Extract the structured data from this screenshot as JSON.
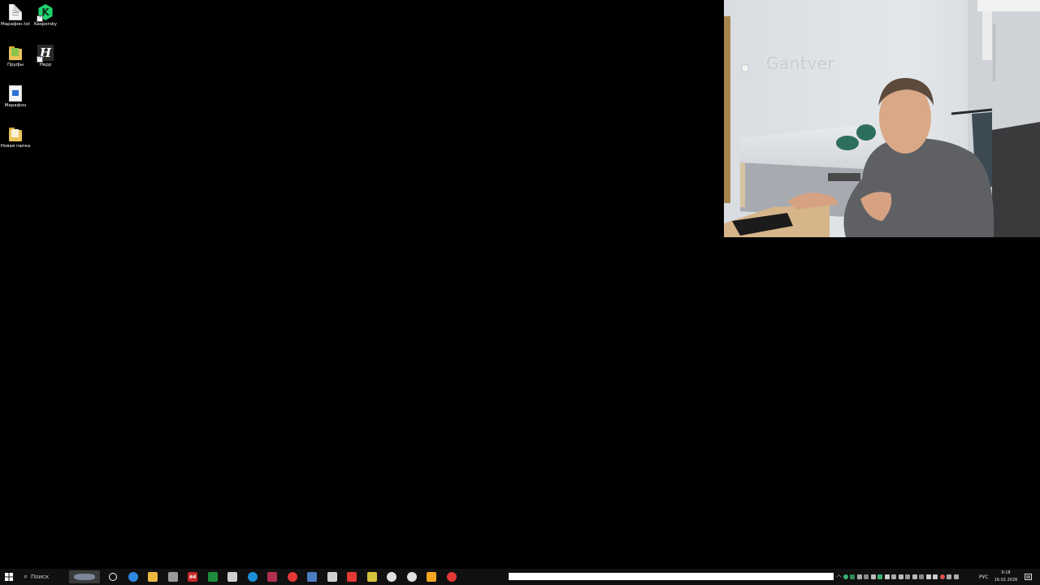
{
  "desktop": {
    "icons": [
      {
        "label": "Марафон.txt",
        "icon": "text-file-icon"
      },
      {
        "label": "Kaspersky",
        "icon": "kaspersky-icon",
        "glyph": "K"
      },
      {
        "label": "Пруфы",
        "icon": "folder-icon"
      },
      {
        "label": "Hepp",
        "icon": "hepp-icon",
        "glyph": "H"
      },
      {
        "label": "Марафон",
        "icon": "document-icon"
      },
      {
        "label": "Новая папка",
        "icon": "folder-icon"
      }
    ]
  },
  "webcam": {
    "wall_text": "Gantver"
  },
  "taskbar": {
    "search_placeholder": "Поиск",
    "pinned": [
      {
        "name": "cortana-icon",
        "color": "#ffffff"
      },
      {
        "name": "edge-icon",
        "color": "#2f88e0"
      },
      {
        "name": "file-explorer-icon",
        "color": "#e9b940"
      },
      {
        "name": "pen-tool-icon",
        "color": "#9a9a9a"
      },
      {
        "name": "aida64-icon",
        "color": "#c62828",
        "text": "64"
      },
      {
        "name": "green-app-icon",
        "color": "#1e8c3a"
      },
      {
        "name": "shield-app-icon",
        "color": "#cfcfcf"
      },
      {
        "name": "edge-blue-icon",
        "color": "#1a8fd6"
      },
      {
        "name": "red-pattern-icon",
        "color": "#b03050"
      },
      {
        "name": "chrome-icon",
        "color": "#e53935"
      },
      {
        "name": "calculator-icon",
        "color": "#4a7ec2"
      },
      {
        "name": "upload-app-icon",
        "color": "#d0d0d0"
      },
      {
        "name": "yandex-icon",
        "color": "#e53935"
      },
      {
        "name": "qr-app-icon",
        "color": "#d6c23a"
      },
      {
        "name": "v2-app-icon",
        "color": "#e0e0e0"
      },
      {
        "name": "crosshair-app-icon",
        "color": "#e0e0e0"
      },
      {
        "name": "orange-app-icon",
        "color": "#f5a623"
      },
      {
        "name": "record-app-icon",
        "color": "#e53935"
      }
    ],
    "tray_icons": [
      "chevron-up-icon",
      "green-circle-icon",
      "green-app-icon",
      "printer-icon",
      "network-icon",
      "monitor-icon",
      "green-monitor-icon",
      "steam-icon",
      "pen-icon",
      "usb-icon",
      "shield-icon",
      "gear-icon",
      "network-icon",
      "speaker-icon",
      "wifi-icon",
      "chrome-icon",
      "battery-icon",
      "keyboard-icon"
    ],
    "language": "РУС",
    "time": "9:18",
    "date": "16.02.2026"
  }
}
